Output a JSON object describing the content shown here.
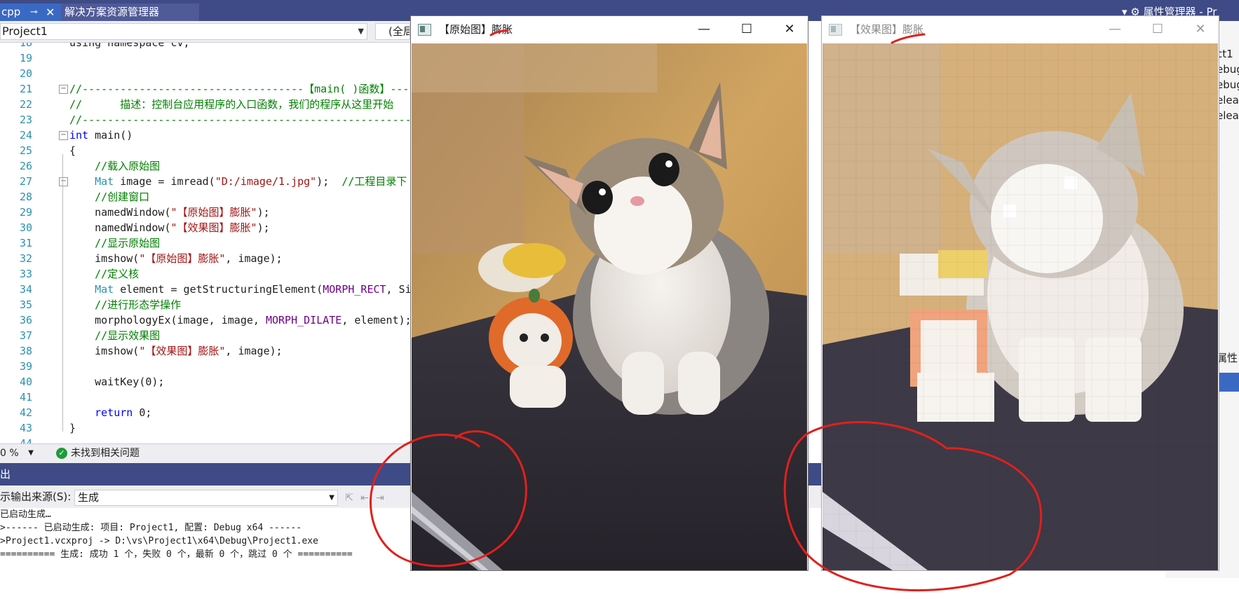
{
  "ide": {
    "tab_active": "cpp",
    "tab_pin": "⊸",
    "tab_close": "✕",
    "tab_solution_explorer": "解决方案资源管理器",
    "top_right_text": "▾ ⚙ 属性管理器 - Pr",
    "project_combo": "Project1",
    "scope_combo": "(全局",
    "zoom": "0 %",
    "issues_text": "未找到相关问题",
    "right_panel_items": [
      "ct1",
      "ebug",
      "ebug",
      "eleas",
      "eleas",
      "属性"
    ]
  },
  "editor": {
    "lines": [
      {
        "n": "18",
        "segs": [
          [
            "using namespace cv;",
            ""
          ]
        ]
      },
      {
        "n": "19",
        "segs": []
      },
      {
        "n": "20",
        "segs": []
      },
      {
        "n": "21",
        "segs": [
          [
            "//-----------------------------------【main( )函数】---",
            "c-green"
          ]
        ],
        "fold": "−"
      },
      {
        "n": "22",
        "segs": [
          [
            "//      描述：控制台应用程序的入口函数，我们的程序从这里开始",
            "c-green"
          ]
        ]
      },
      {
        "n": "23",
        "segs": [
          [
            "//-----------------------------------------------------------",
            "c-green"
          ]
        ]
      },
      {
        "n": "24",
        "segs": [
          [
            "int",
            "c-blue"
          ],
          [
            " main()",
            ""
          ]
        ],
        "fold": "−"
      },
      {
        "n": "25",
        "segs": [
          [
            "{",
            ""
          ]
        ]
      },
      {
        "n": "26",
        "segs": [
          [
            "    //载入原始图",
            "c-green"
          ]
        ]
      },
      {
        "n": "27",
        "segs": [
          [
            "    ",
            ""
          ],
          [
            "Mat",
            "c-type"
          ],
          [
            " image = imread(",
            ""
          ],
          [
            "\"D:/image/1.jpg\"",
            "c-red"
          ],
          [
            ");  ",
            ""
          ],
          [
            "//工程目录下",
            "c-green"
          ]
        ],
        "fold": "−"
      },
      {
        "n": "28",
        "segs": [
          [
            "    //创建窗口",
            "c-green"
          ]
        ]
      },
      {
        "n": "29",
        "segs": [
          [
            "    namedWindow(",
            ""
          ],
          [
            "\"【原始图】膨胀\"",
            "c-red"
          ],
          [
            ");",
            ""
          ]
        ]
      },
      {
        "n": "30",
        "segs": [
          [
            "    namedWindow(",
            ""
          ],
          [
            "\"【效果图】膨胀\"",
            "c-red"
          ],
          [
            ");",
            ""
          ]
        ]
      },
      {
        "n": "31",
        "segs": [
          [
            "    //显示原始图",
            "c-green"
          ]
        ]
      },
      {
        "n": "32",
        "segs": [
          [
            "    imshow(",
            ""
          ],
          [
            "\"【原始图】膨胀\"",
            "c-red"
          ],
          [
            ", image);",
            ""
          ]
        ]
      },
      {
        "n": "33",
        "segs": [
          [
            "    //定义核",
            "c-green"
          ]
        ]
      },
      {
        "n": "34",
        "segs": [
          [
            "    ",
            ""
          ],
          [
            "Mat",
            "c-type"
          ],
          [
            " element = getStructuringElement(",
            ""
          ],
          [
            "MORPH_RECT",
            "c-purp"
          ],
          [
            ", Siz",
            ""
          ]
        ]
      },
      {
        "n": "35",
        "segs": [
          [
            "    //进行形态学操作",
            "c-green"
          ]
        ]
      },
      {
        "n": "36",
        "segs": [
          [
            "    morphologyEx(image, image, ",
            ""
          ],
          [
            "MORPH_DILATE",
            "c-purp"
          ],
          [
            ", element);",
            ""
          ]
        ]
      },
      {
        "n": "37",
        "segs": [
          [
            "    //显示效果图",
            "c-green"
          ]
        ]
      },
      {
        "n": "38",
        "segs": [
          [
            "    imshow(",
            ""
          ],
          [
            "\"【效果图】膨胀\"",
            "c-red"
          ],
          [
            ", image);",
            ""
          ]
        ]
      },
      {
        "n": "39",
        "segs": []
      },
      {
        "n": "40",
        "segs": [
          [
            "    waitKey(0);",
            ""
          ]
        ]
      },
      {
        "n": "41",
        "segs": []
      },
      {
        "n": "42",
        "segs": [
          [
            "    ",
            ""
          ],
          [
            "return",
            "c-blue"
          ],
          [
            " 0;",
            ""
          ]
        ]
      },
      {
        "n": "43",
        "segs": [
          [
            "}",
            ""
          ]
        ]
      },
      {
        "n": "44",
        "segs": []
      }
    ]
  },
  "output": {
    "title": "出",
    "source_label": "示输出来源(S):",
    "source_value": "生成",
    "lines": [
      "已启动生成…",
      ">------ 已启动生成: 项目: Project1, 配置: Debug x64 ------",
      ">Project1.vcxproj -> D:\\vs\\Project1\\x64\\Debug\\Project1.exe",
      "========== 生成: 成功 1 个，失败 0 个，最新 0 个，跳过 0 个 =========="
    ]
  },
  "windows": {
    "original": {
      "title": "【原始图】膨胀",
      "minimize": "—",
      "maximize": "☐",
      "close": "✕"
    },
    "effect": {
      "title": "【效果图】膨胀",
      "minimize": "—",
      "maximize": "☐",
      "close": "✕"
    }
  },
  "colors": {
    "annotation_red": "#e0201c",
    "ide_blue": "#3f4b86",
    "photo_wall": "#c89a55",
    "photo_table": "#2f2c33"
  }
}
